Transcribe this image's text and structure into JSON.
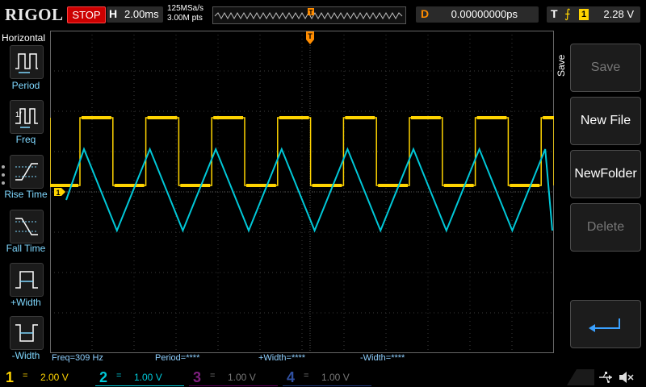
{
  "header": {
    "brand": "RIGOL",
    "run_state": "STOP",
    "horizontal": {
      "key": "H",
      "timebase": "2.00ms"
    },
    "sample_rate": "125MSa/s",
    "memory_depth": "3.00M pts",
    "trigger_marker": "T",
    "delay": {
      "key": "D",
      "value": "0.00000000ps"
    },
    "trigger": {
      "key": "T",
      "edge_icon": "rising-edge-icon",
      "source": "1",
      "level": "2.28 V"
    }
  },
  "left_panel": {
    "title": "Horizontal",
    "items": [
      {
        "label": "Period",
        "icon": "period-icon"
      },
      {
        "label": "Freq",
        "icon": "frequency-icon"
      },
      {
        "label": "Rise Time",
        "icon": "rise-time-icon"
      },
      {
        "label": "Fall Time",
        "icon": "fall-time-icon"
      },
      {
        "label": "+Width",
        "icon": "positive-width-icon"
      },
      {
        "label": "-Width",
        "icon": "negative-width-icon"
      }
    ]
  },
  "right_panel": {
    "title": "Save",
    "buttons": [
      {
        "label": "Save",
        "enabled": false
      },
      {
        "label": "New File",
        "enabled": true
      },
      {
        "label": "NewFolder",
        "enabled": true
      },
      {
        "label": "Delete",
        "enabled": false
      },
      {
        "label": "",
        "icon": "return-arrow-icon",
        "enabled": true
      }
    ]
  },
  "markers": {
    "ch1": "1",
    "trigger_level": "T"
  },
  "measurements": {
    "freq": "Freq=309 Hz",
    "period": "Period=****",
    "pos_width": "+Width=****",
    "neg_width": "-Width=****"
  },
  "channels": [
    {
      "num": "1",
      "coupling": "=",
      "scale": "2.00 V",
      "color": "#ffd400",
      "active": true
    },
    {
      "num": "2",
      "coupling": "=",
      "scale": "1.00 V",
      "color": "#00c8d8",
      "active": true
    },
    {
      "num": "3",
      "coupling": "=",
      "scale": "1.00 V",
      "color": "#c000c0",
      "active": false
    },
    {
      "num": "4",
      "coupling": "=",
      "scale": "1.00 V",
      "color": "#3070ff",
      "active": false
    }
  ],
  "status_icons": [
    "usb-icon",
    "mute-icon"
  ],
  "colors": {
    "ch1": "#ffd400",
    "ch2": "#00c8d8",
    "trigger": "#ff8c00",
    "stop": "#cc0000"
  }
}
